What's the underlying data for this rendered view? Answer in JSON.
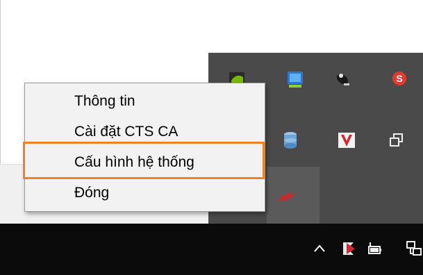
{
  "context_menu": {
    "items": [
      {
        "label": "Thông tin"
      },
      {
        "label": "Cài đặt CTS CA"
      },
      {
        "label": "Cấu hình hệ thống"
      },
      {
        "label": "Đóng"
      }
    ],
    "highlighted_index": 2,
    "highlight_color": "#f08223"
  },
  "tray_icons": [
    "nvidia-icon",
    "monitor-app-icon",
    "satellite-dish-icon",
    "red-s-icon",
    "database-icon",
    "red-v-icon",
    "window-copy-icon",
    "red-signature-icon"
  ],
  "taskbar_icons": [
    "chevron-up-icon",
    "kaspersky-icon",
    "battery-icon",
    "network-icon"
  ]
}
